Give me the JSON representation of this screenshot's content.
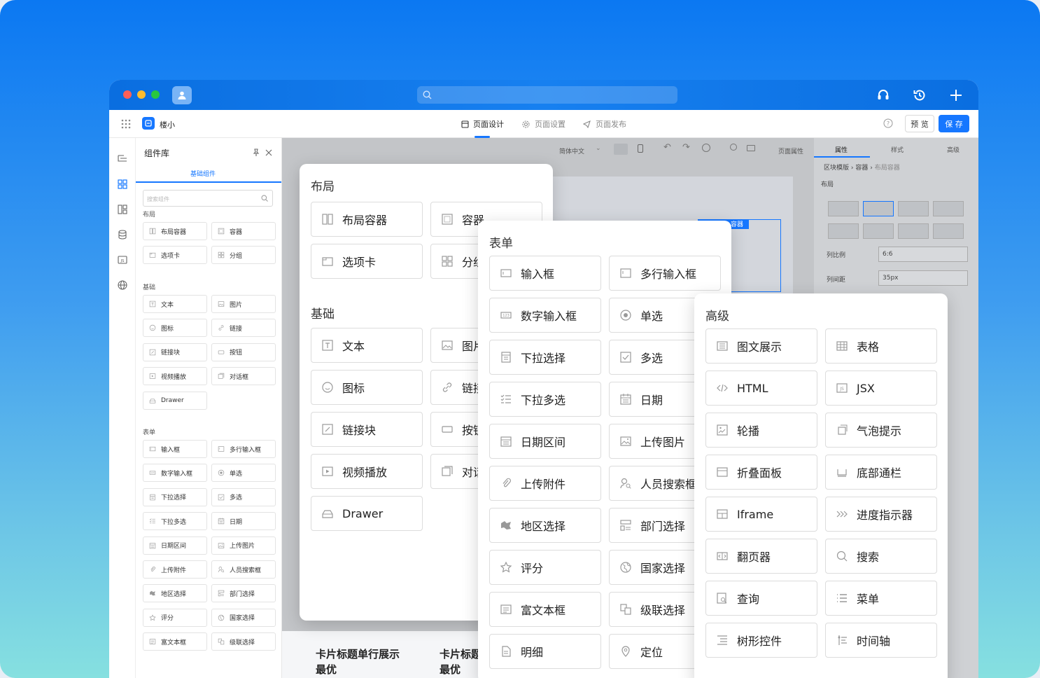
{
  "app": {
    "name": "楼小",
    "search_placeholder": ""
  },
  "header_tabs": [
    {
      "label": "页面设计",
      "active": true,
      "icon": "page-design-icon"
    },
    {
      "label": "页面设置",
      "active": false,
      "icon": "settings-icon"
    },
    {
      "label": "页面发布",
      "active": false,
      "icon": "publish-icon"
    }
  ],
  "header_actions": {
    "preview": "预 览",
    "save": "保 存"
  },
  "colors": {
    "accent": "#1677ff",
    "titlebar": "#0a6ee0"
  },
  "library": {
    "title": "组件库",
    "tab": "基础组件",
    "search_placeholder": "搜索组件",
    "sections": [
      {
        "title": "布局",
        "items": [
          "布局容器",
          "容器",
          "选项卡",
          "分组"
        ]
      },
      {
        "title": "基础",
        "items": [
          "文本",
          "图片",
          "图标",
          "链接",
          "链接块",
          "按钮",
          "视频播放",
          "对话框",
          "Drawer"
        ]
      },
      {
        "title": "表单",
        "items": [
          "输入框",
          "多行输入框",
          "数字输入框",
          "单选",
          "下拉选择",
          "多选",
          "下拉多选",
          "日期",
          "日期区间",
          "上传图片",
          "上传附件",
          "人员搜索框",
          "地区选择",
          "部门选择",
          "评分",
          "国家选择",
          "富文本框",
          "级联选择"
        ]
      }
    ]
  },
  "canvas_toolbar": {
    "language": "简体中文",
    "page_props": "页面属性"
  },
  "canvas": {
    "card1": "卡片标题单行展示",
    "card1_sub": "最优",
    "card2": "卡片标题",
    "card2_sub": "最优",
    "selected_label": "容器"
  },
  "right_panel": {
    "tabs": [
      "属性",
      "样式",
      "高级"
    ],
    "breadcrumb": [
      "区块模版",
      "容器",
      "布局容器"
    ],
    "section": "布局",
    "fields": [
      {
        "label": "列比例",
        "value": "6:6"
      },
      {
        "label": "列间距",
        "value": "35px"
      }
    ]
  },
  "cards": {
    "layout": {
      "title": "布局",
      "items": [
        {
          "label": "布局容器",
          "icon": "layout-container-icon"
        },
        {
          "label": "容器",
          "icon": "container-icon"
        },
        {
          "label": "选项卡",
          "icon": "tab-icon"
        },
        {
          "label": "分组",
          "icon": "group-icon"
        }
      ]
    },
    "basic": {
      "title": "基础",
      "items": [
        {
          "label": "文本",
          "icon": "text-icon"
        },
        {
          "label": "图片",
          "icon": "image-icon"
        },
        {
          "label": "图标",
          "icon": "smile-icon"
        },
        {
          "label": "链接",
          "icon": "link-icon"
        },
        {
          "label": "链接块",
          "icon": "link-block-icon"
        },
        {
          "label": "按钮",
          "icon": "button-icon"
        },
        {
          "label": "视频播放",
          "icon": "video-icon"
        },
        {
          "label": "对话框",
          "icon": "dialog-icon"
        },
        {
          "label": "Drawer",
          "icon": "drawer-icon"
        }
      ]
    },
    "form": {
      "title": "表单",
      "items": [
        {
          "label": "输入框",
          "icon": "input-icon"
        },
        {
          "label": "多行输入框",
          "icon": "textarea-icon"
        },
        {
          "label": "数字输入框",
          "icon": "number-input-icon"
        },
        {
          "label": "单选",
          "icon": "radio-icon"
        },
        {
          "label": "下拉选择",
          "icon": "select-icon"
        },
        {
          "label": "多选",
          "icon": "checkbox-icon"
        },
        {
          "label": "下拉多选",
          "icon": "multi-select-icon"
        },
        {
          "label": "日期",
          "icon": "calendar-icon"
        },
        {
          "label": "日期区间",
          "icon": "date-range-icon"
        },
        {
          "label": "上传图片",
          "icon": "upload-image-icon"
        },
        {
          "label": "上传附件",
          "icon": "attachment-icon"
        },
        {
          "label": "人员搜索框",
          "icon": "user-search-icon"
        },
        {
          "label": "地区选择",
          "icon": "region-icon"
        },
        {
          "label": "部门选择",
          "icon": "department-icon"
        },
        {
          "label": "评分",
          "icon": "star-icon"
        },
        {
          "label": "国家选择",
          "icon": "globe-icon"
        },
        {
          "label": "富文本框",
          "icon": "richtext-icon"
        },
        {
          "label": "级联选择",
          "icon": "cascade-icon"
        },
        {
          "label": "明细",
          "icon": "detail-icon"
        },
        {
          "label": "定位",
          "icon": "location-icon"
        }
      ]
    },
    "advanced": {
      "title": "高级",
      "items": [
        {
          "label": "图文展示",
          "icon": "image-text-icon"
        },
        {
          "label": "表格",
          "icon": "table-icon"
        },
        {
          "label": "HTML",
          "icon": "code-icon"
        },
        {
          "label": "JSX",
          "icon": "jsx-icon"
        },
        {
          "label": "轮播",
          "icon": "carousel-icon"
        },
        {
          "label": "气泡提示",
          "icon": "tooltip-icon"
        },
        {
          "label": "折叠面板",
          "icon": "collapse-icon"
        },
        {
          "label": "底部通栏",
          "icon": "footer-bar-icon"
        },
        {
          "label": "Iframe",
          "icon": "iframe-icon"
        },
        {
          "label": "进度指示器",
          "icon": "progress-icon"
        },
        {
          "label": "翻页器",
          "icon": "pagination-icon"
        },
        {
          "label": "搜索",
          "icon": "search-icon"
        },
        {
          "label": "查询",
          "icon": "query-icon"
        },
        {
          "label": "菜单",
          "icon": "menu-icon"
        },
        {
          "label": "树形控件",
          "icon": "tree-icon"
        },
        {
          "label": "时间轴",
          "icon": "timeline-icon"
        }
      ]
    }
  }
}
